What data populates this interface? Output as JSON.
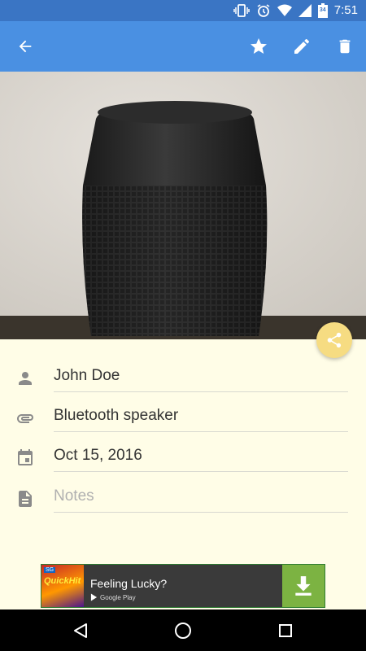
{
  "status_bar": {
    "time": "7:51",
    "battery_level": "34",
    "icons": [
      "vibrate-icon",
      "alarm-icon",
      "wifi-icon",
      "signal-icon",
      "battery-icon"
    ]
  },
  "toolbar": {
    "icons": [
      "back-arrow-icon",
      "star-icon",
      "pencil-icon",
      "trash-icon"
    ]
  },
  "photo": {
    "subject": "Bluetooth speaker"
  },
  "details": {
    "person": "John Doe",
    "item": "Bluetooth speaker",
    "date": "Oct 15, 2016",
    "notes_placeholder": "Notes"
  },
  "ad": {
    "thumb_badge": "SG",
    "thumb_label": "QuickHit",
    "title": "Feeling Lucky?",
    "store": "Google Play"
  },
  "colors": {
    "primary": "#4a90e2",
    "primary_dark": "#3a75c4",
    "background": "#fffde7",
    "fab": "#f6dc82",
    "ad_download": "#7cb342"
  }
}
